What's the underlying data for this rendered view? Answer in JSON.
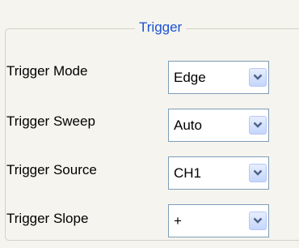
{
  "group": {
    "title": "Trigger"
  },
  "fields": [
    {
      "label": "Trigger Mode",
      "value": "Edge"
    },
    {
      "label": "Trigger Sweep",
      "value": "Auto"
    },
    {
      "label": "Trigger Source",
      "value": "CH1"
    },
    {
      "label": "Trigger Slope",
      "value": "+"
    }
  ],
  "icons": {
    "dropdown": "chevron-down-icon"
  },
  "colors": {
    "title": "#1c53d6",
    "field_border": "#7f9db9",
    "button_arrow": "#4d6185",
    "background": "#f5f4ee"
  }
}
